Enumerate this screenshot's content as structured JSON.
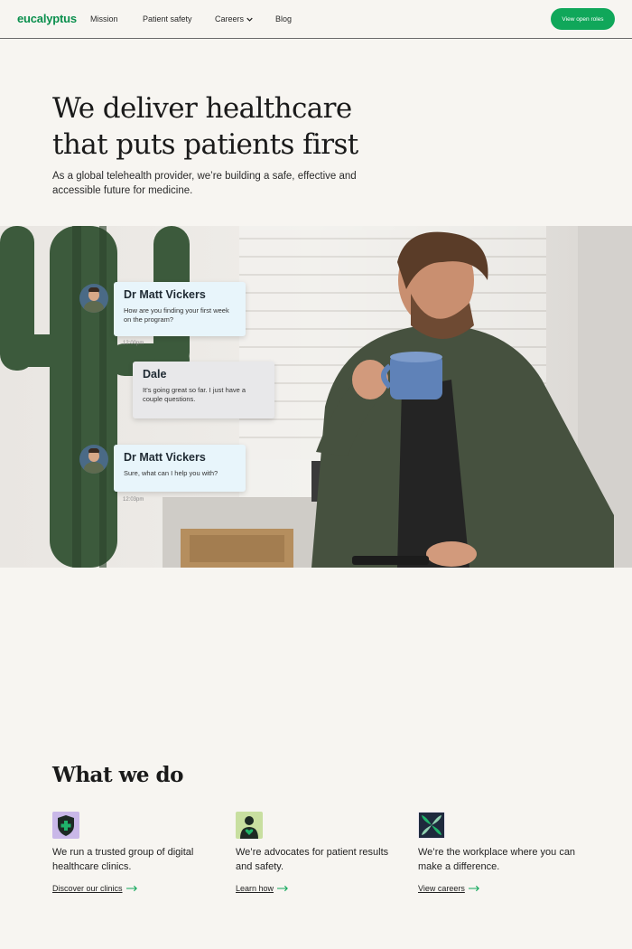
{
  "nav": {
    "logo": "eucalyptus",
    "links": [
      "Mission",
      "Patient safety",
      "Careers",
      "Blog"
    ],
    "cta": "View open roles"
  },
  "hero": {
    "title": "We deliver healthcare that puts patients first",
    "subtitle": "As a global telehealth provider, we’re building a safe, effective and accessible future for medicine."
  },
  "chat": [
    {
      "name": "Dr Matt Vickers",
      "message": "How are you finding your first week on the program?",
      "time": "12:00pm"
    },
    {
      "name": "Dale",
      "message": "It’s going great so far. I just have a couple questions."
    },
    {
      "name": "Dr Matt Vickers",
      "message": "Sure, what can I help you with?",
      "time": "12:03pm"
    }
  ],
  "what_we_do": {
    "title": "What we do",
    "cards": [
      {
        "icon": "shield-plus-icon",
        "text": "We run a trusted group of digital healthcare clinics.",
        "link": "Discover our clinics"
      },
      {
        "icon": "person-heart-icon",
        "text": "We’re advocates for patient results and safety.",
        "link": "Learn how"
      },
      {
        "icon": "leaf-cross-icon",
        "text": "We’re the workplace where you can make a difference.",
        "link": "View careers"
      }
    ]
  },
  "colors": {
    "brand": "#10a75a",
    "background": "#f7f5f1"
  }
}
